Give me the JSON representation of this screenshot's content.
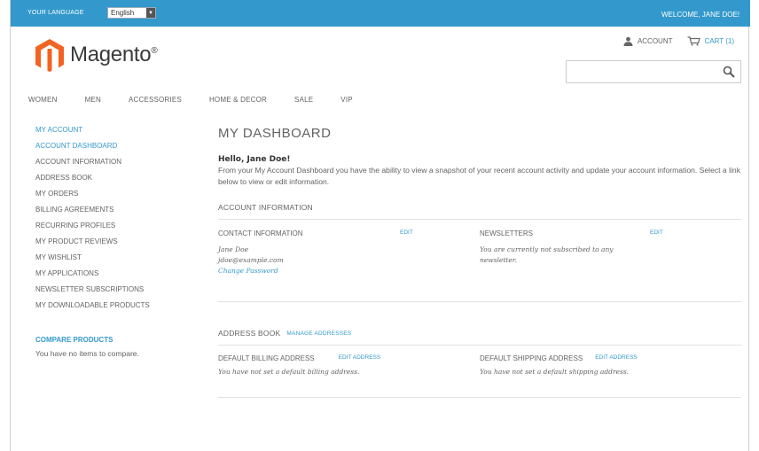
{
  "topbar": {
    "language_label": "YOUR LANGUAGE",
    "language_value": "English",
    "welcome": "WELCOME, JANE DOE!"
  },
  "logo": {
    "name": "Magento",
    "mark": "®"
  },
  "header": {
    "account": "ACCOUNT",
    "cart": "CART (1)",
    "search_placeholder": ""
  },
  "nav": [
    "WOMEN",
    "MEN",
    "ACCESSORIES",
    "HOME & DECOR",
    "SALE",
    "VIP"
  ],
  "sidebar": {
    "title": "MY ACCOUNT",
    "items": [
      "ACCOUNT DASHBOARD",
      "ACCOUNT INFORMATION",
      "ADDRESS BOOK",
      "MY ORDERS",
      "BILLING AGREEMENTS",
      "RECURRING PROFILES",
      "MY PRODUCT REVIEWS",
      "MY WISHLIST",
      "MY APPLICATIONS",
      "NEWSLETTER SUBSCRIPTIONS",
      "MY DOWNLOADABLE PRODUCTS"
    ],
    "compare_title": "COMPARE PRODUCTS",
    "compare_text": "You have no items to compare."
  },
  "main": {
    "title": "MY DASHBOARD",
    "hello": "Hello, Jane Doe!",
    "intro": "From your My Account Dashboard you have the ability to view a snapshot of your recent account activity and update your account information. Select a link below to view or edit information.",
    "account_info": {
      "heading": "ACCOUNT INFORMATION",
      "contact_heading": "CONTACT INFORMATION",
      "contact_edit": "EDIT",
      "name": "Jane Doe",
      "email": "jdoe@example.com",
      "change_password": "Change Password",
      "newsletters_heading": "NEWSLETTERS",
      "newsletters_edit": "EDIT",
      "newsletters_text": "You are currently not subscribed to any newsletter."
    },
    "address_book": {
      "heading": "ADDRESS BOOK",
      "manage": "MANAGE ADDRESSES",
      "billing_heading": "DEFAULT BILLING ADDRESS",
      "billing_edit": "EDIT ADDRESS",
      "billing_text": "You have not set a default billing address.",
      "shipping_heading": "DEFAULT SHIPPING ADDRESS",
      "shipping_edit": "EDIT ADDRESS",
      "shipping_text": "You have not set a default shipping address."
    }
  },
  "colors": {
    "accent": "#3399cc",
    "brand_orange": "#f26322",
    "text": "#636363"
  }
}
